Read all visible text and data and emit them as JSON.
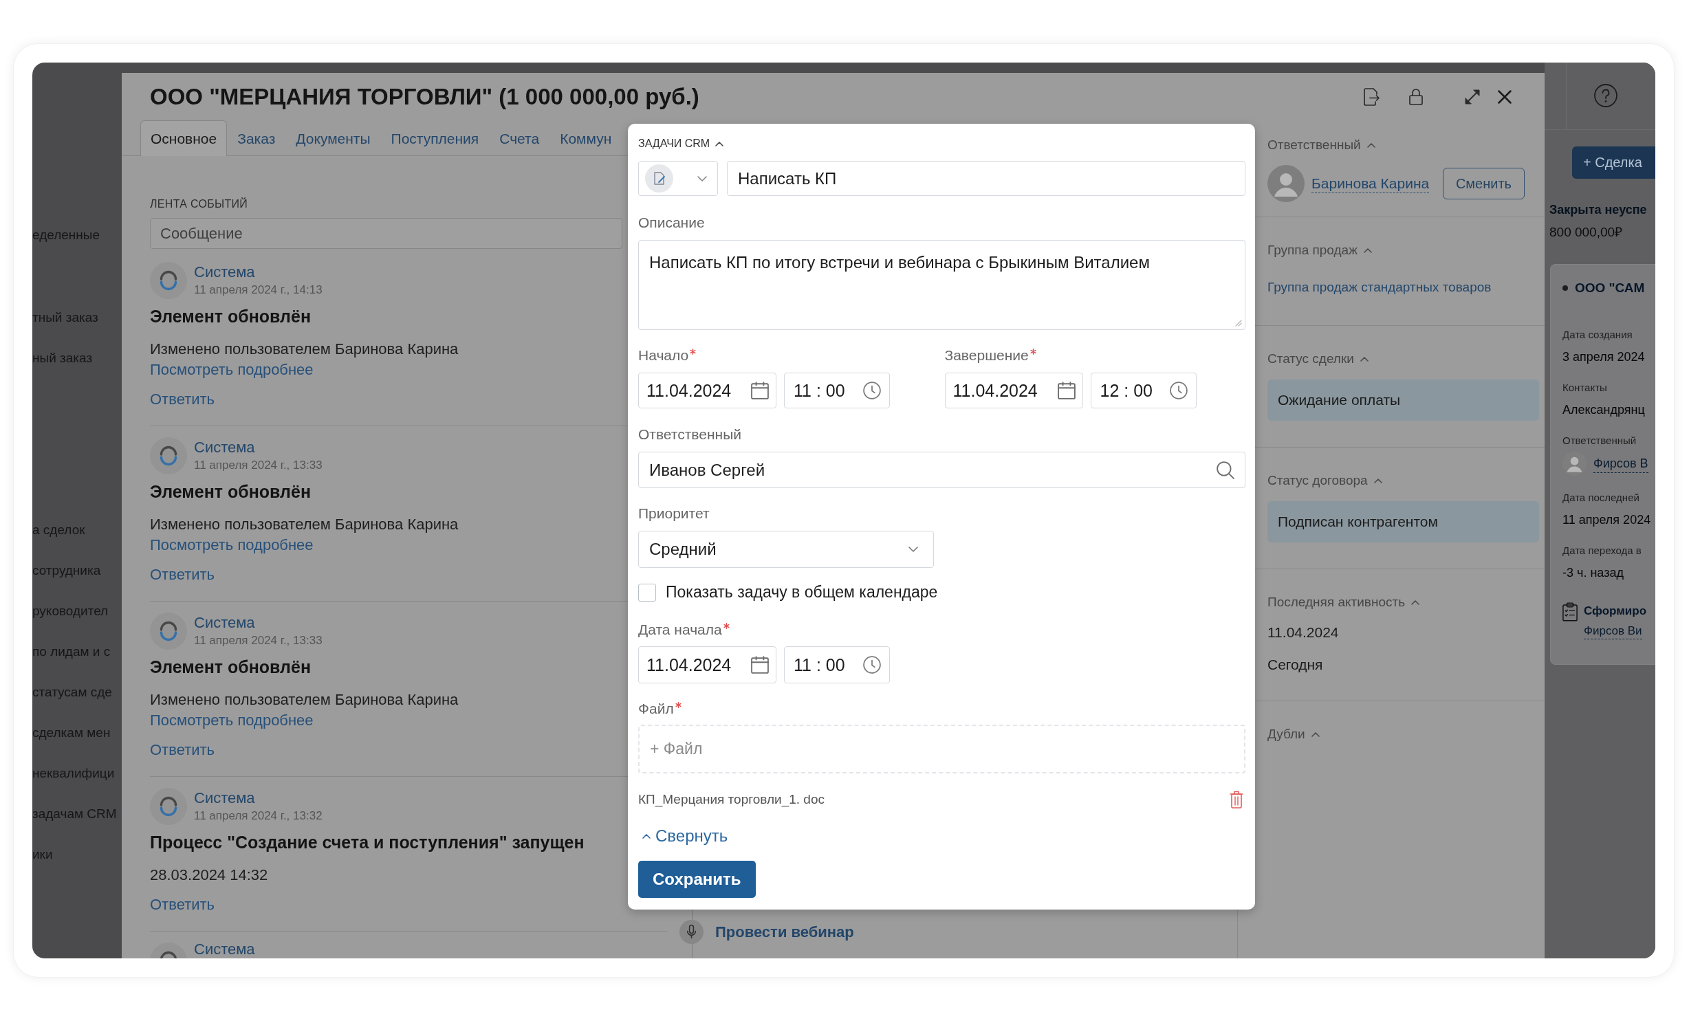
{
  "app_sidebar": {
    "groups": [
      {
        "items": [
          "еделенные"
        ]
      },
      {
        "items": [
          "тный заказ",
          "ный заказ"
        ]
      },
      {
        "items": [
          "а сделок",
          "сотрудника",
          "руководител",
          "по лидам и с",
          "статусам сде",
          "сделкам мен",
          "неквалифици",
          "задачам CRM",
          "ики"
        ]
      }
    ]
  },
  "deal": {
    "title": "ООО \"МЕРЦАНИЯ ТОРГОВЛИ\" (1 000 000,00 руб.)",
    "tabs": [
      {
        "label": "Основное",
        "selected": true
      },
      {
        "label": "Заказ",
        "selected": false
      },
      {
        "label": "Документы",
        "selected": false
      },
      {
        "label": "Поступления",
        "selected": false
      },
      {
        "label": "Счета",
        "selected": false
      },
      {
        "label": "Коммун",
        "selected": false
      }
    ],
    "feed": {
      "label": "ЛЕНТА СОБЫТИЙ",
      "message": {
        "placeholder": "Сообщение"
      },
      "events": [
        {
          "author": "Система",
          "date": "11 апреля 2024 г., 14:13",
          "title": "Элемент обновлён",
          "text": "Изменено пользователем Баринова Карина",
          "link": "Посмотреть подробнее",
          "reply": "Ответить"
        },
        {
          "author": "Система",
          "date": "11 апреля 2024 г., 13:33",
          "title": "Элемент обновлён",
          "text": "Изменено пользователем Баринова Карина",
          "link": "Посмотреть подробнее",
          "reply": "Ответить"
        },
        {
          "author": "Система",
          "date": "11 апреля 2024 г., 13:33",
          "title": "Элемент обновлён",
          "text": "Изменено пользователем Баринова Карина",
          "link": "Посмотреть подробнее",
          "reply": "Ответить"
        },
        {
          "author": "Система",
          "date": "11 апреля 2024 г., 13:32",
          "title": "Процесс \"Создание счета и поступления\" запущен",
          "text": "28.03.2024 14:32",
          "reply": "Ответить"
        },
        {
          "author": "Система"
        }
      ]
    },
    "tasks": [
      {
        "title": "Провести вебинар"
      }
    ],
    "sidebar": {
      "sections": [
        {
          "kind": "person",
          "title": "Ответственный",
          "name": "Баринова Карина",
          "button": "Сменить"
        },
        {
          "kind": "link",
          "title": "Группа продаж",
          "value": "Группа продаж стандартных товаров"
        },
        {
          "kind": "status",
          "title": "Статус сделки",
          "value": "Ожидание оплаты"
        },
        {
          "kind": "status",
          "title": "Статус договора",
          "value": "Подписан контрагентом"
        },
        {
          "kind": "lines",
          "title": "Последняя активность",
          "lines": [
            "11.04.2024",
            "Сегодня"
          ]
        },
        {
          "kind": "empty",
          "title": "Дубли"
        }
      ]
    }
  },
  "right_panel": {
    "button": "+ Сделка",
    "status": "Закрыта неуспе",
    "amount": "800 000,00₽",
    "card": {
      "title": "ООО \"САМ",
      "fields": [
        {
          "kind": "text",
          "label": "Дата создания",
          "value": "3 апреля 2024"
        },
        {
          "kind": "text",
          "label": "Контакты",
          "value": "Александрянц"
        },
        {
          "kind": "person",
          "label": "Ответственный",
          "value": "Фирсов В"
        },
        {
          "kind": "text",
          "label": "Дата последней",
          "value": "11 апреля 2024"
        },
        {
          "kind": "text",
          "label": "Дата перехода в",
          "value": "-3 ч. назад"
        }
      ],
      "task": {
        "title": "Сформиро",
        "assignee": "Фирсов Ви"
      }
    }
  },
  "task_modal": {
    "heading": "ЗАДАЧИ CRM",
    "task_name": "Написать КП",
    "description": {
      "label": "Описание",
      "required": false,
      "value": "Написать КП по итогу встречи и вебинара с Брыкиным Виталием"
    },
    "period": [
      {
        "label": "Начало",
        "required": true,
        "date": "11.04.2024",
        "time": "11 : 00"
      },
      {
        "label": "Завершение",
        "required": true,
        "date": "11.04.2024",
        "time": "12 : 00"
      }
    ],
    "assignee": {
      "label": "Ответственный",
      "required": false,
      "value": "Иванов Сергей"
    },
    "priority": {
      "label": "Приоритет",
      "required": false,
      "value": "Средний"
    },
    "calendar_checkbox": {
      "label": "Показать задачу в общем календаре",
      "checked": false
    },
    "start_date": {
      "label": "Дата начала",
      "required": true,
      "date": "11.04.2024",
      "time": "11 : 00"
    },
    "file": {
      "label": "Файл",
      "required": true,
      "add_label": "+ Файл",
      "attachments": [
        "КП_Мерцания торговли_1. doc"
      ]
    },
    "collapse": "Свернуть",
    "save": "Сохранить"
  }
}
